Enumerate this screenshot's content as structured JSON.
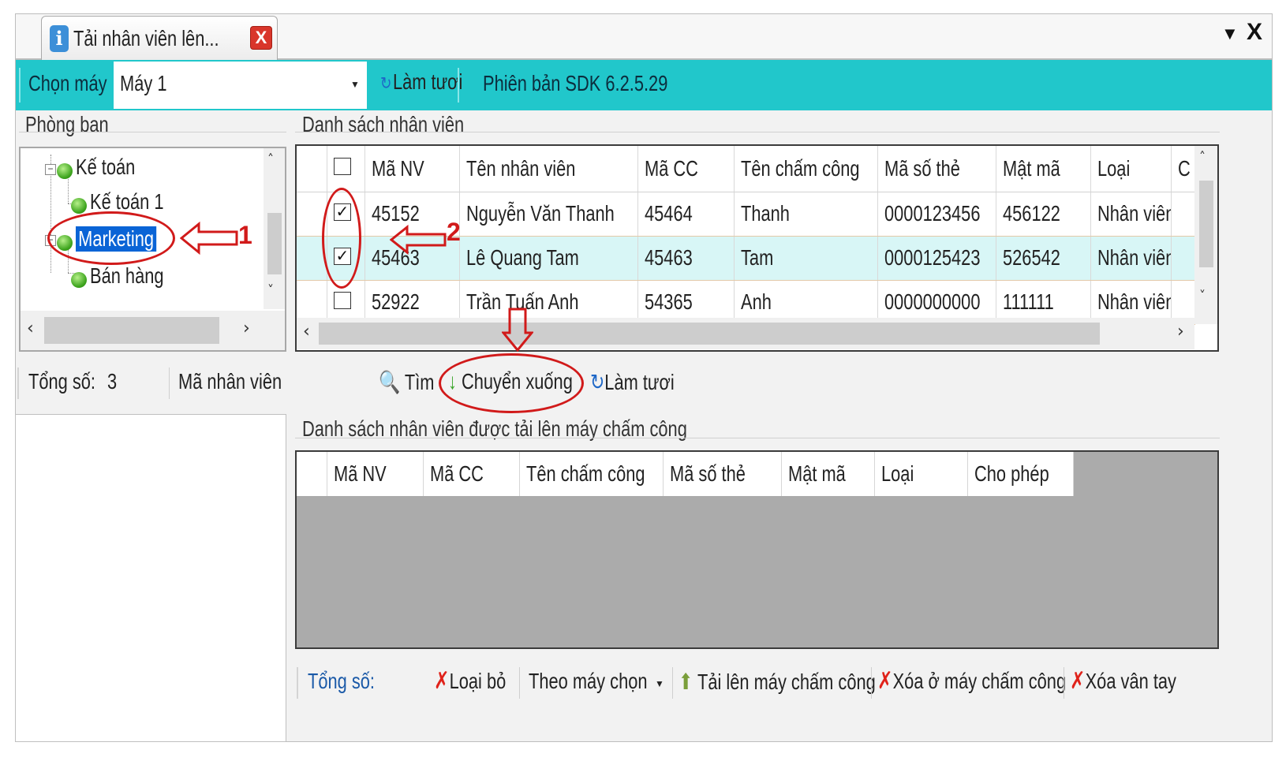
{
  "window": {
    "tab_title": "Tải nhân viên lên...",
    "tab_icon": "info-icon",
    "close_glyph": "X",
    "pin_glyph": "▼",
    "window_close_glyph": "X"
  },
  "toolbar": {
    "chon_may_label": "Chọn máy",
    "machine_value": "Máy 1",
    "refresh_label": "Làm tươi",
    "sdk_label": "Phiên bản SDK  6.2.5.29"
  },
  "phong_ban": {
    "title": "Phòng ban",
    "items": [
      {
        "label": "Kế toán",
        "level": 0
      },
      {
        "label": "Kế toán 1",
        "level": 1
      },
      {
        "label": "Marketing",
        "level": 0,
        "selected": true
      },
      {
        "label": "Bán hàng",
        "level": 1
      }
    ]
  },
  "employee_list": {
    "title": "Danh sách nhân viên",
    "columns": [
      "Mã NV",
      "Tên nhân viên",
      "Mã CC",
      "Tên chấm công",
      "Mã số thẻ",
      "Mật mã",
      "Loại",
      "C"
    ],
    "rows": [
      {
        "checked": true,
        "ma_nv": "45152",
        "ten": "Nguyễn Văn Thanh",
        "ma_cc": "45464",
        "ten_cc": "Thanh",
        "ma_the": "0000123456",
        "mat_ma": "456122",
        "loai": "Nhân viên"
      },
      {
        "checked": true,
        "ma_nv": "45463",
        "ten": "Lê Quang Tam",
        "ma_cc": "45463",
        "ten_cc": "Tam",
        "ma_the": "0000125423",
        "mat_ma": "526542",
        "loai": "Nhân viên"
      },
      {
        "checked": false,
        "ma_nv": "52922",
        "ten": "Trần Tuấn Anh",
        "ma_cc": "54365",
        "ten_cc": "Anh",
        "ma_the": "0000000000",
        "mat_ma": "111111",
        "loai": "Nhân viên"
      }
    ]
  },
  "filter_bar": {
    "total_label": "Tổng số:",
    "total_value": "3",
    "search_label": "Mã nhân viên",
    "find_label": "Tìm",
    "move_down_label": "Chuyển xuống",
    "refresh_label": "Làm tươi"
  },
  "upload_list": {
    "title": "Danh sách nhân viên được tải lên máy chấm công",
    "columns": [
      "Mã NV",
      "Mã CC",
      "Tên chấm công",
      "Mã số thẻ",
      "Mật mã",
      "Loại",
      "Cho phép"
    ]
  },
  "bottom_bar": {
    "total_label": "Tổng số:",
    "remove_label": "Loại bỏ",
    "mode_value": "Theo máy chọn",
    "upload_label": "Tải lên máy chấm công",
    "delete_machine_label": "Xóa ở máy chấm công",
    "delete_fingerprint_label": "Xóa vân tay"
  },
  "annotations": {
    "step1": "1",
    "step2": "2"
  },
  "colors": {
    "toolbar": "#21c7cb",
    "selection": "#0a64d6",
    "annotation": "#d11a1a",
    "selected_row": "#d8f6f6"
  }
}
